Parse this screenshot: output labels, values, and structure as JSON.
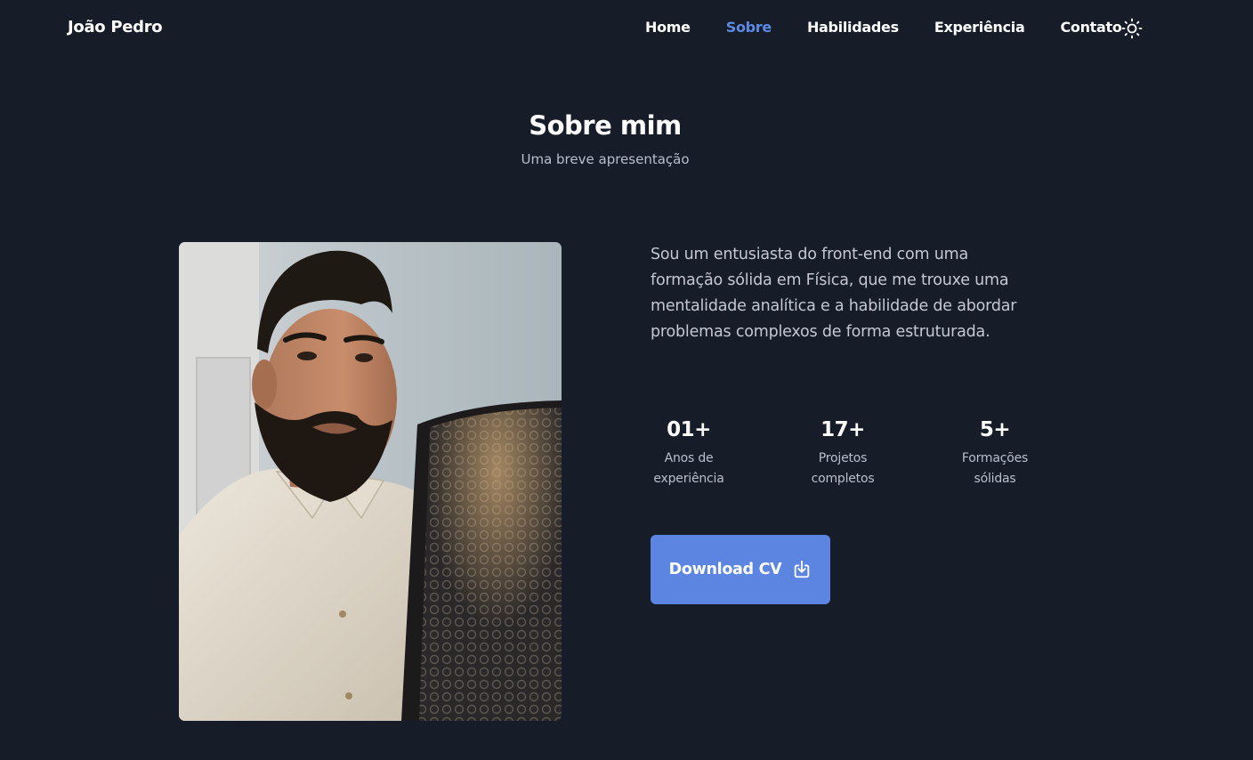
{
  "header": {
    "brand": "João Pedro",
    "nav": [
      "Home",
      "Sobre",
      "Habilidades",
      "Experiência",
      "Contato"
    ],
    "active_nav": "Sobre",
    "theme_icon": "sun-icon"
  },
  "about": {
    "title": "Sobre mim",
    "subtitle": "Uma breve apresentação",
    "description": "Sou um entusiasta do front-end com uma formação sólida em Física, que me trouxe uma mentalidade analítica e a habilidade de abordar problemas complexos de forma estruturada.",
    "stats": [
      {
        "value": "01+",
        "label_line1": "Anos de",
        "label_line2": "experiência"
      },
      {
        "value": "17+",
        "label_line1": "Projetos",
        "label_line2": "completos"
      },
      {
        "value": "5+",
        "label_line1": "Formações",
        "label_line2": "sólidas"
      }
    ],
    "download_label": "Download CV",
    "download_icon": "download-icon"
  },
  "colors": {
    "background": "#171c29",
    "accent": "#5b85e0",
    "active_link": "#5b8ae2",
    "muted_text": "#b9bfcc"
  }
}
